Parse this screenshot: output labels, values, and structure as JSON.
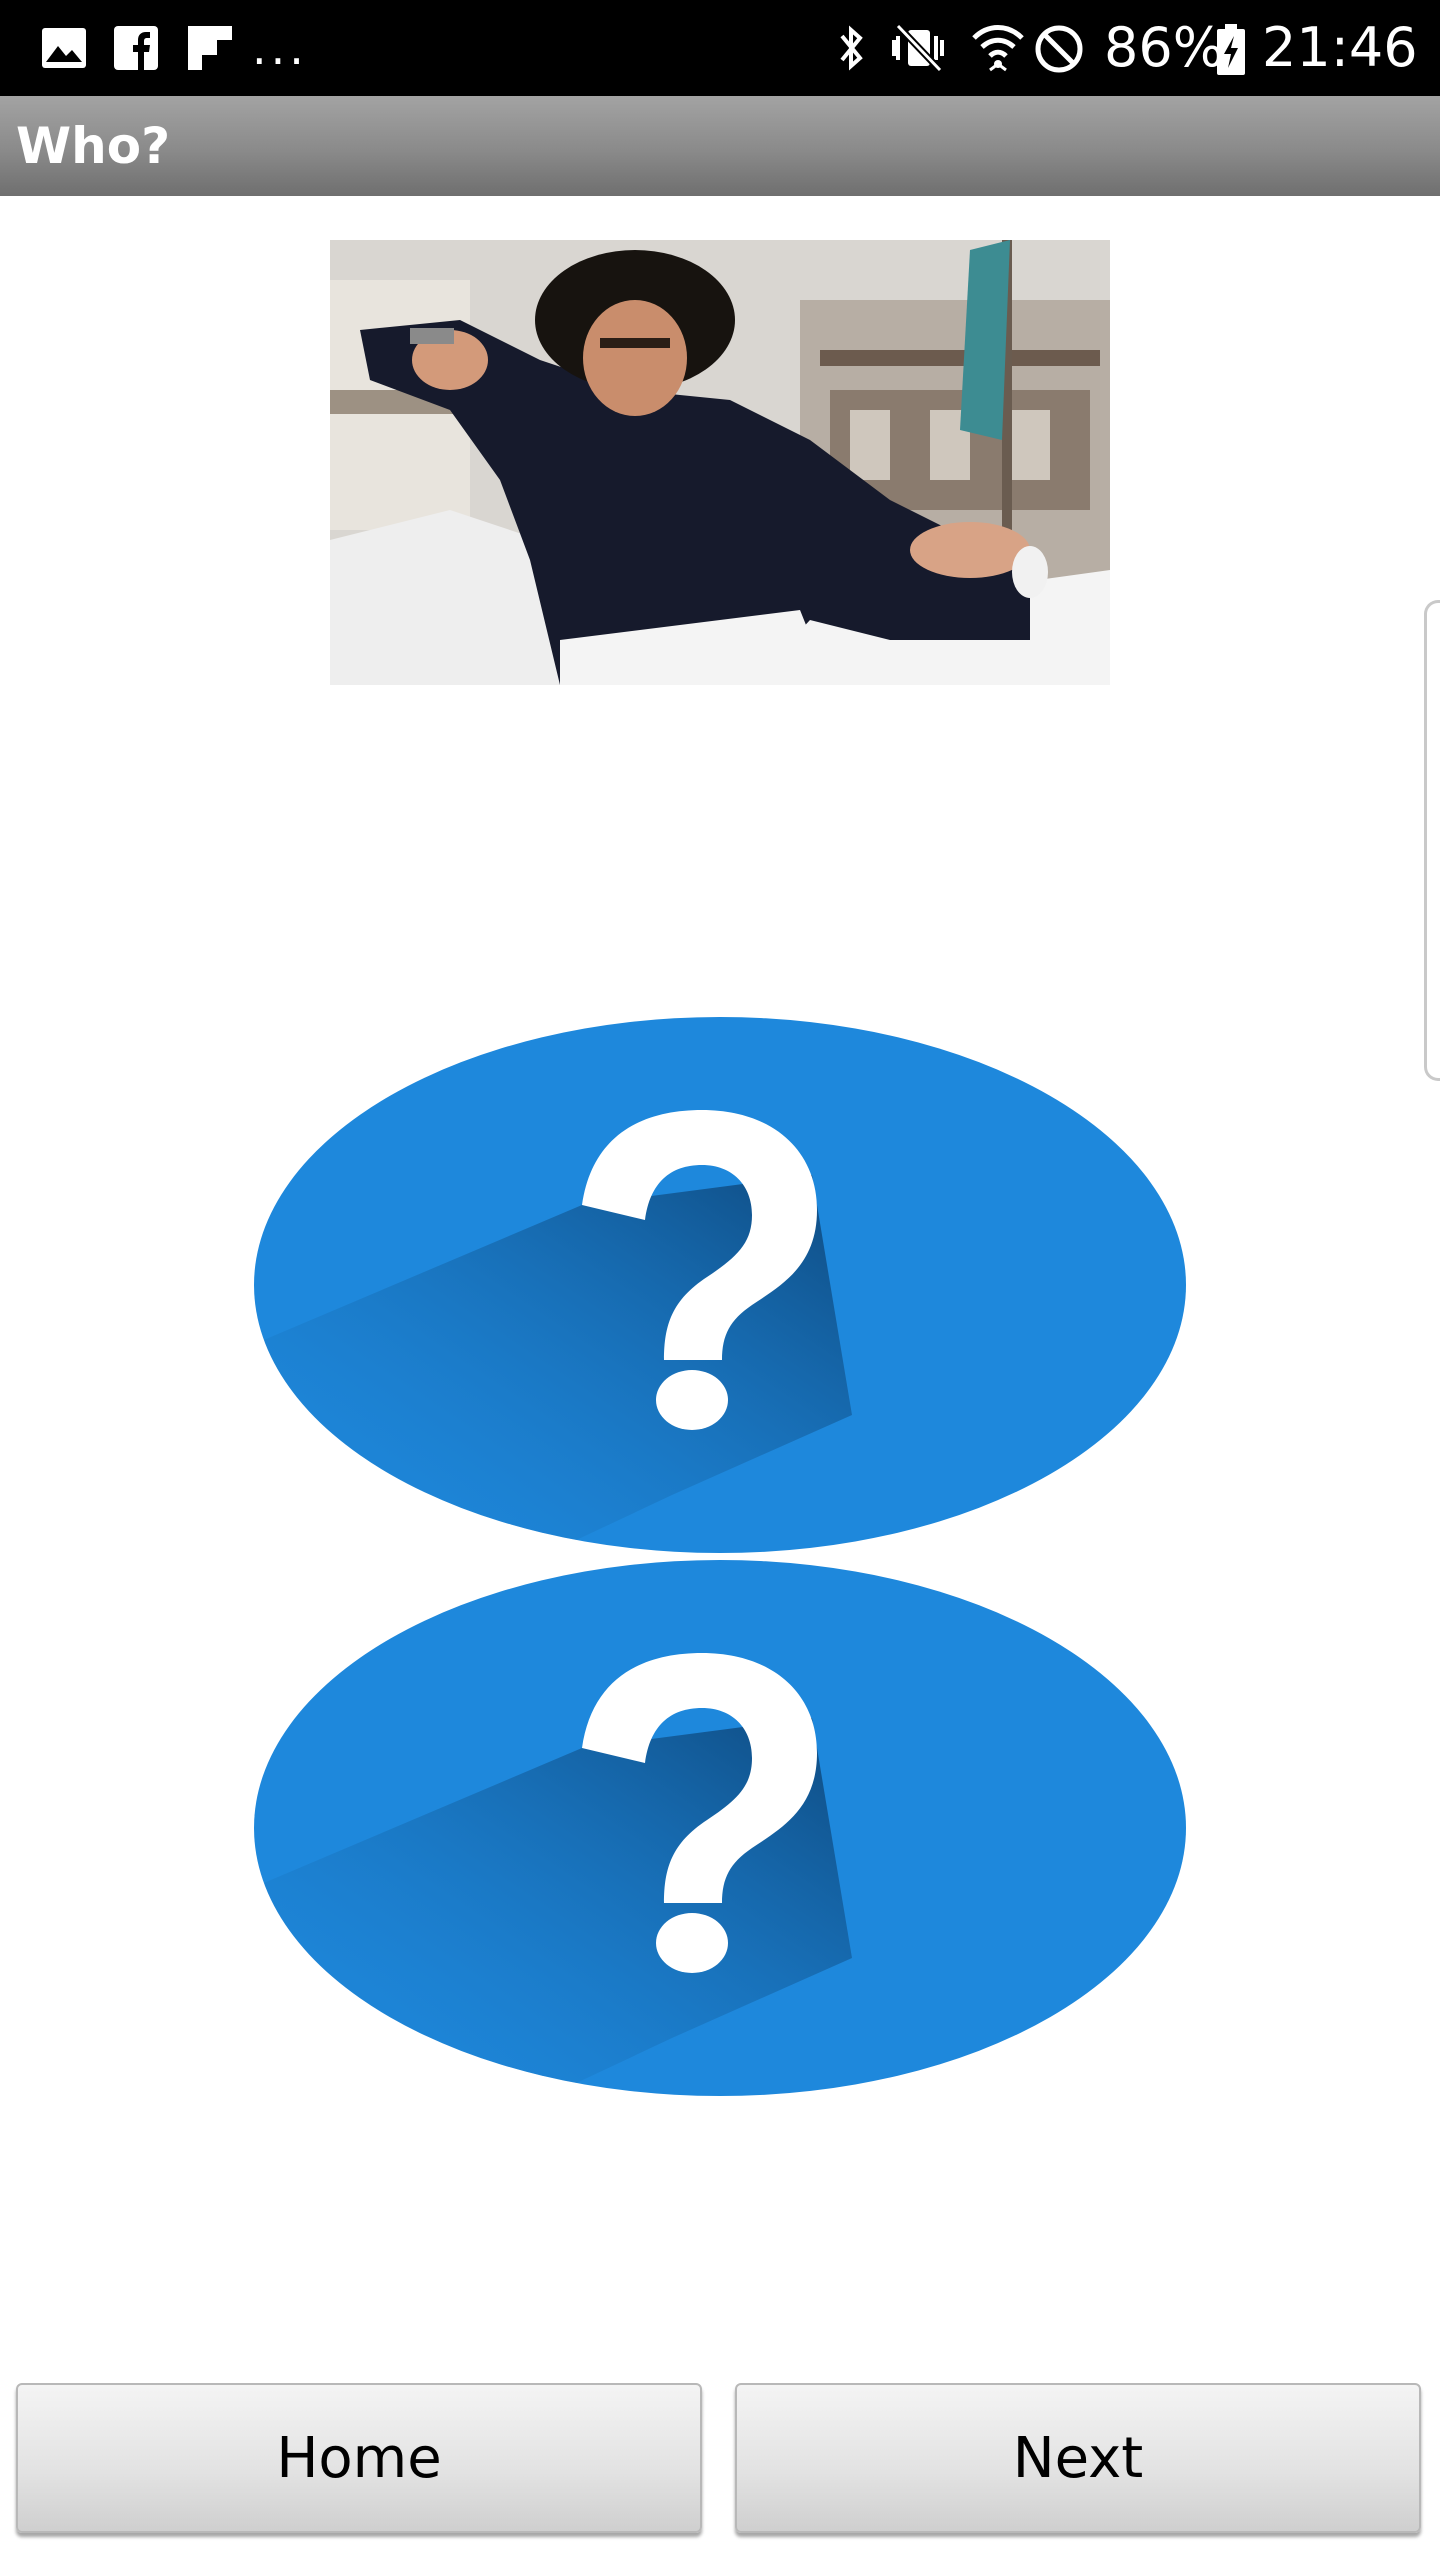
{
  "status_bar": {
    "notifications": [
      "gallery-icon",
      "facebook-icon",
      "flipboard-icon"
    ],
    "more": "...",
    "system_icons": [
      "bluetooth-icon",
      "vibrate-icon",
      "wifi-icon",
      "do-not-disturb-icon",
      "battery-charging-icon"
    ],
    "battery": "86%",
    "time": "21:46"
  },
  "app_bar": {
    "title": "Who?"
  },
  "quiz": {
    "photo_icon": "person-photo",
    "options": [
      {
        "icon": "question-mark-icon",
        "color": "#1e88dc"
      },
      {
        "icon": "question-mark-icon",
        "color": "#1e88dc"
      }
    ]
  },
  "buttons": {
    "home": "Home",
    "next": "Next"
  },
  "colors": {
    "status_bar": "#000000",
    "title_bar": "#8a8a8a",
    "accent_blue": "#1e88dc",
    "background": "#ffffff"
  }
}
